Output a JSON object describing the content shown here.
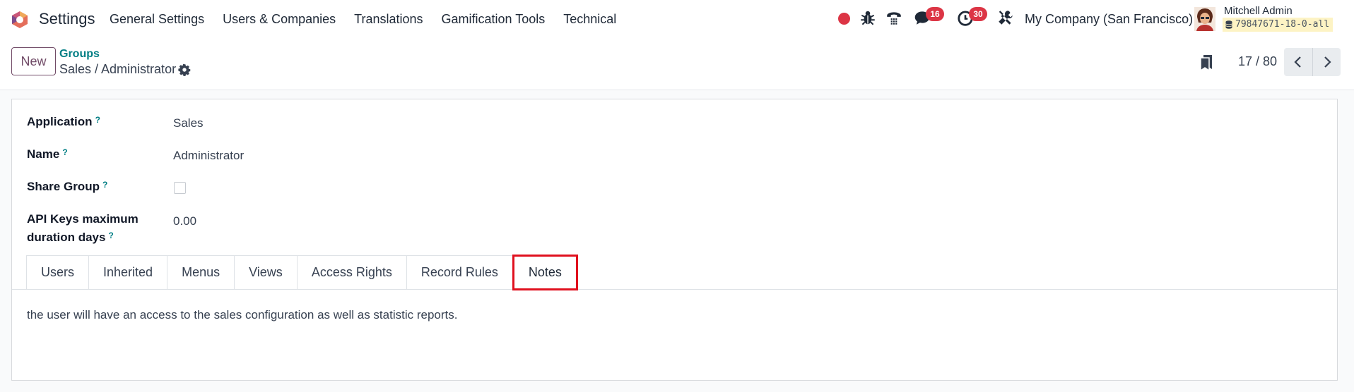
{
  "navbar": {
    "app_name": "Settings",
    "menu": [
      "General Settings",
      "Users & Companies",
      "Translations",
      "Gamification Tools",
      "Technical"
    ],
    "messages_count": "16",
    "activities_count": "30",
    "company": "My Company (San Francisco)",
    "user_name": "Mitchell Admin",
    "database": "79847671-18-0-all"
  },
  "control": {
    "new_label": "New",
    "breadcrumb_parent": "Groups",
    "breadcrumb_current": "Sales / Administrator",
    "pager": "17 / 80"
  },
  "form": {
    "fields": {
      "application_label": "Application",
      "application_value": "Sales",
      "name_label": "Name",
      "name_value": "Administrator",
      "share_label": "Share Group",
      "api_label_1": "API Keys maximum",
      "api_label_2": "duration days",
      "api_value": "0.00",
      "help": "?"
    },
    "tabs": [
      "Users",
      "Inherited",
      "Menus",
      "Views",
      "Access Rights",
      "Record Rules",
      "Notes"
    ],
    "active_tab": "Notes",
    "notes_text": "the user will have an access to the sales configuration as well as statistic reports."
  },
  "colors": {
    "brand": "#714b67",
    "link": "#017e84",
    "badge": "#dc3545",
    "highlight": "#e0101e"
  }
}
